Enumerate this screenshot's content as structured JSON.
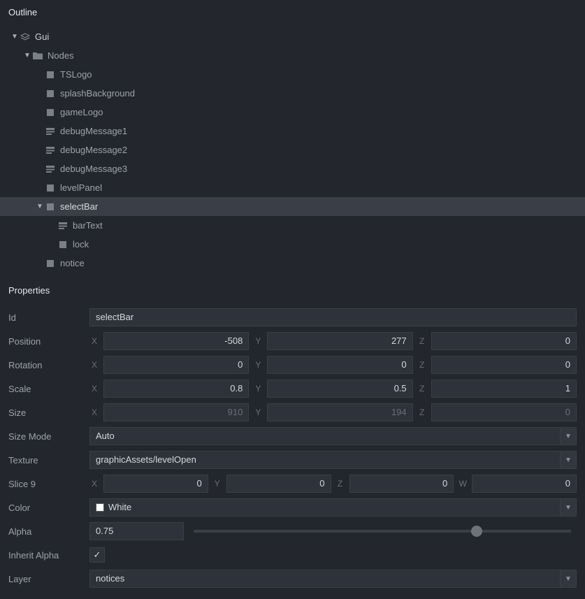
{
  "outline": {
    "title": "Outline",
    "tree": [
      {
        "depth": 0,
        "arrow": "down",
        "icon": "gui",
        "label": "Gui",
        "root": true
      },
      {
        "depth": 1,
        "arrow": "down",
        "icon": "folder",
        "label": "Nodes"
      },
      {
        "depth": 2,
        "arrow": "none",
        "icon": "box",
        "label": "TSLogo"
      },
      {
        "depth": 2,
        "arrow": "none",
        "icon": "box",
        "label": "splashBackground"
      },
      {
        "depth": 2,
        "arrow": "none",
        "icon": "box",
        "label": "gameLogo"
      },
      {
        "depth": 2,
        "arrow": "none",
        "icon": "text",
        "label": "debugMessage1"
      },
      {
        "depth": 2,
        "arrow": "none",
        "icon": "text",
        "label": "debugMessage2"
      },
      {
        "depth": 2,
        "arrow": "none",
        "icon": "text",
        "label": "debugMessage3"
      },
      {
        "depth": 2,
        "arrow": "none",
        "icon": "box",
        "label": "levelPanel"
      },
      {
        "depth": 2,
        "arrow": "down",
        "icon": "box",
        "label": "selectBar",
        "selected": true
      },
      {
        "depth": 3,
        "arrow": "none",
        "icon": "text",
        "label": "barText"
      },
      {
        "depth": 3,
        "arrow": "none",
        "icon": "box",
        "label": "lock"
      },
      {
        "depth": 2,
        "arrow": "none",
        "icon": "box",
        "label": "notice"
      }
    ]
  },
  "properties": {
    "title": "Properties",
    "labels": {
      "id": "Id",
      "position": "Position",
      "rotation": "Rotation",
      "scale": "Scale",
      "size": "Size",
      "sizeMode": "Size Mode",
      "texture": "Texture",
      "slice9": "Slice 9",
      "color": "Color",
      "alpha": "Alpha",
      "inheritAlpha": "Inherit Alpha",
      "layer": "Layer"
    },
    "axes": {
      "x": "X",
      "y": "Y",
      "z": "Z",
      "w": "W"
    },
    "id": "selectBar",
    "position": {
      "x": "-508",
      "y": "277",
      "z": "0"
    },
    "rotation": {
      "x": "0",
      "y": "0",
      "z": "0"
    },
    "scale": {
      "x": "0.8",
      "y": "0.5",
      "z": "1"
    },
    "size": {
      "x": "910",
      "y": "194",
      "z": "0"
    },
    "sizeMode": "Auto",
    "texture": "graphicAssets/levelOpen",
    "slice9": {
      "x": "0",
      "y": "0",
      "z": "0",
      "w": "0"
    },
    "color": "White",
    "alpha": "0.75",
    "alphaPercent": 75,
    "inheritAlpha": true,
    "layer": "notices"
  }
}
